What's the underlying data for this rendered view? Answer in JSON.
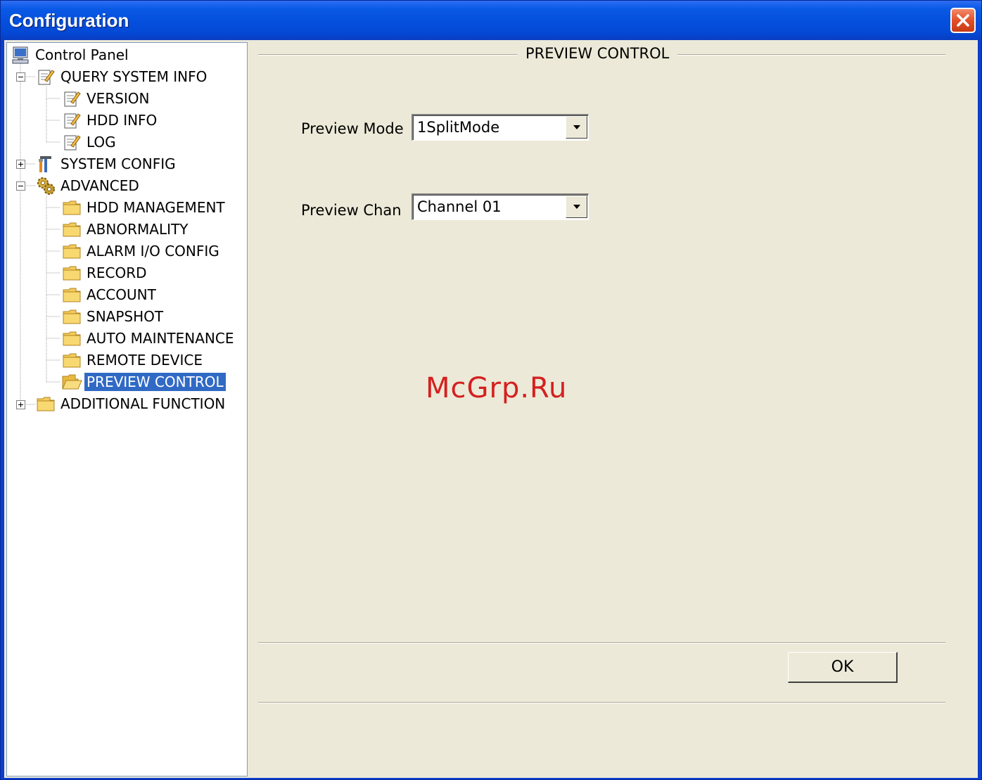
{
  "window": {
    "title": "Configuration",
    "close_icon": "close-icon"
  },
  "tree": {
    "root": {
      "label": "Control Panel",
      "icon": "computer-icon"
    },
    "nodes": [
      {
        "label": "QUERY SYSTEM INFO",
        "icon": "edit-document-icon",
        "expanded": true
      },
      {
        "label": "VERSION",
        "icon": "edit-document-icon"
      },
      {
        "label": "HDD INFO",
        "icon": "edit-document-icon"
      },
      {
        "label": "LOG",
        "icon": "edit-document-icon"
      },
      {
        "label": "SYSTEM CONFIG",
        "icon": "tools-icon",
        "expanded": false
      },
      {
        "label": "ADVANCED",
        "icon": "gears-icon",
        "expanded": true
      },
      {
        "label": "HDD MANAGEMENT",
        "icon": "folder-icon"
      },
      {
        "label": "ABNORMALITY",
        "icon": "folder-icon"
      },
      {
        "label": "ALARM I/O CONFIG",
        "icon": "folder-icon"
      },
      {
        "label": "RECORD",
        "icon": "folder-icon"
      },
      {
        "label": "ACCOUNT",
        "icon": "folder-icon"
      },
      {
        "label": "SNAPSHOT",
        "icon": "folder-icon"
      },
      {
        "label": "AUTO MAINTENANCE",
        "icon": "folder-icon"
      },
      {
        "label": "REMOTE DEVICE",
        "icon": "folder-icon"
      },
      {
        "label": "PREVIEW CONTROL",
        "icon": "open-folder-icon",
        "selected": true
      },
      {
        "label": "ADDITIONAL FUNCTION",
        "icon": "folder-icon",
        "expanded": false
      }
    ]
  },
  "panel": {
    "section_title": "PREVIEW CONTROL",
    "preview_mode": {
      "label": "Preview Mode",
      "value": "1SplitMode"
    },
    "preview_chan": {
      "label": "Preview Chan",
      "value": "Channel 01"
    },
    "ok_label": "OK"
  },
  "watermark": "McGrp.Ru",
  "colors": {
    "titlebar": "#0550de",
    "dialog_background": "#ece9d8",
    "selection": "#316ac5",
    "watermark": "#d42020"
  }
}
